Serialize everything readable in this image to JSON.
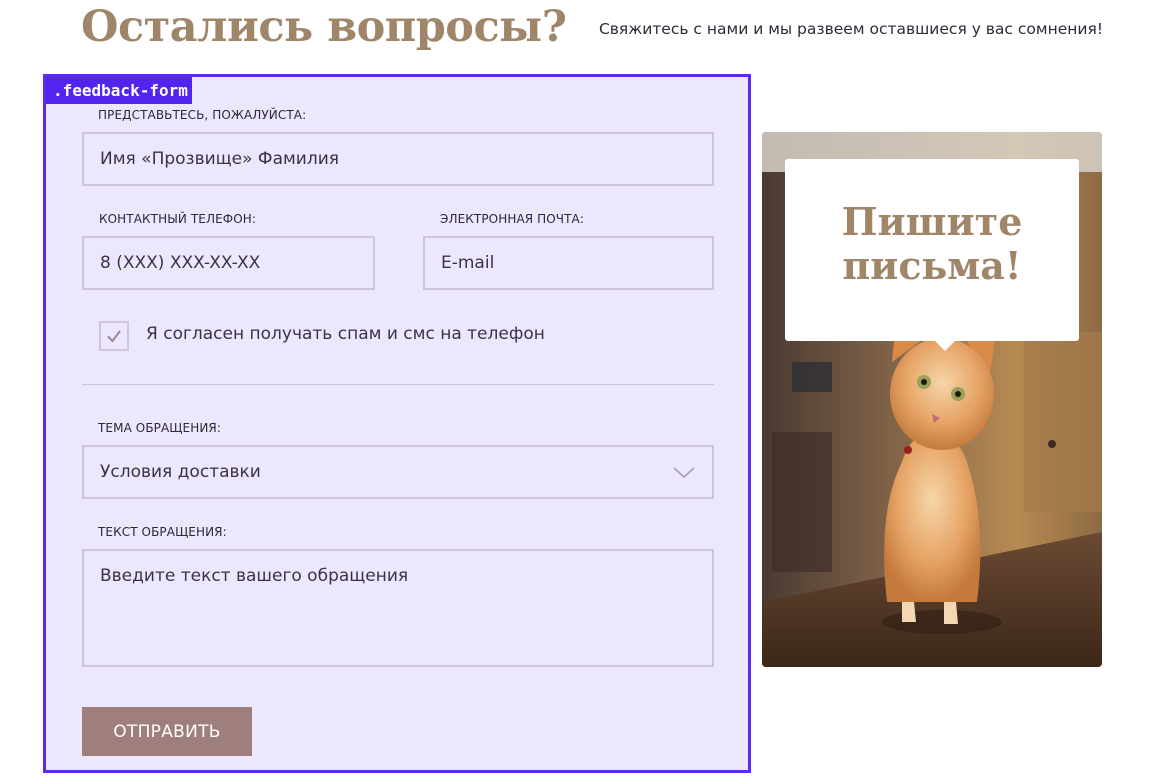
{
  "header": {
    "title": "Остались вопросы?",
    "subtitle": "Свяжитесь с нами и мы развеем оставшиеся у вас сомнения!"
  },
  "form": {
    "tag": ".feedback-form",
    "name": {
      "label": "Представьтесь, пожалуйста:",
      "placeholder": "Имя «Прозвище» Фамилия"
    },
    "phone": {
      "label": "Контактный телефон:",
      "placeholder": "8 (XXX) XXX-XX-XX"
    },
    "email": {
      "label": "Электронная почта:",
      "placeholder": "E-mail"
    },
    "consent": {
      "label": "Я согласен получать спам и смс на телефон",
      "checked": true
    },
    "topic": {
      "label": "Тема обращения:",
      "value": "Условия доставки"
    },
    "message": {
      "label": "Текст обращения:",
      "placeholder": "Введите текст вашего обращения"
    },
    "submit_label": "Отправить"
  },
  "promo": {
    "bubble_text": "Пишите\nписьма!"
  },
  "colors": {
    "accent_brown": "#a08669",
    "button": "#9f7f7e",
    "panel_bg": "#ece7fd",
    "panel_border": "#5b2bf0"
  },
  "icons": {
    "checkbox": "checkmark-icon",
    "select": "chevron-down-icon"
  }
}
